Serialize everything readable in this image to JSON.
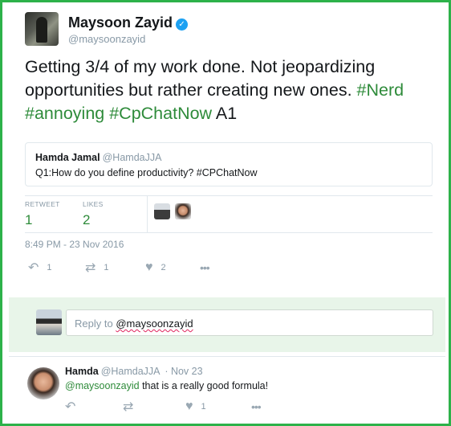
{
  "author": {
    "name": "Maysoon Zayid",
    "handle": "@maysoonzayid",
    "verified_icon": "verified-check-icon"
  },
  "tweet": {
    "text": "Getting 3/4 of my work done. Not jeopardizing opportunities but rather creating new ones.",
    "hashtags": [
      "#Nerd",
      "#annoying",
      "#CpChatNow"
    ],
    "suffix": "A1",
    "timestamp": "8:49 PM - 23 Nov 2016"
  },
  "quoted": {
    "name": "Hamda Jamal",
    "handle": "@HamdaJJA",
    "text": "Q1:How do you define productivity? #CPChatNow"
  },
  "stats": {
    "retweet_label": "RETWEET",
    "retweet_count": "1",
    "likes_label": "LIKES",
    "likes_count": "2"
  },
  "actions": {
    "reply_icon": "reply-icon",
    "reply_count": "1",
    "retweet_icon": "retweet-icon",
    "retweet_count": "1",
    "like_icon": "heart-icon",
    "like_count": "2",
    "more_icon": "more-dots-icon"
  },
  "reply_composer": {
    "prefix": "Reply to",
    "mention": "@maysoonzayid"
  },
  "reply": {
    "name": "Hamda",
    "handle": "@HamdaJJA",
    "date": "· Nov 23",
    "mention": "@maysoonzayid",
    "text": "that is a really good formula!",
    "like_count": "1"
  },
  "colors": {
    "border": "#2db24a",
    "hashtag": "#2e8b3a",
    "verified": "#1da1f2",
    "reply_bg": "#e8f5e9"
  }
}
